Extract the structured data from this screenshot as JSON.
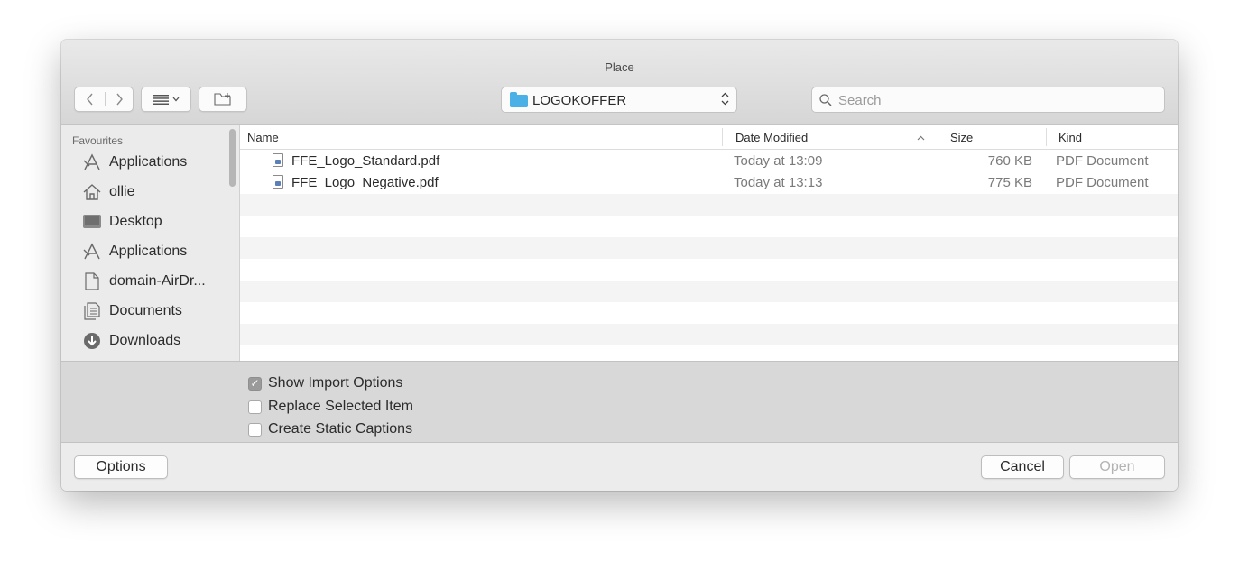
{
  "window": {
    "title": "Place"
  },
  "toolbar": {
    "back_icon": "chevron-left-icon",
    "forward_icon": "chevron-right-icon",
    "view_icon": "list-view-icon",
    "new_folder_icon": "new-folder-icon",
    "location": "LOGOKOFFER",
    "search_placeholder": "Search"
  },
  "sidebar": {
    "heading": "Favourites",
    "items": [
      {
        "label": "Applications",
        "icon": "applications-icon"
      },
      {
        "label": "ollie",
        "icon": "home-icon"
      },
      {
        "label": "Desktop",
        "icon": "desktop-icon"
      },
      {
        "label": "Applications",
        "icon": "applications-icon"
      },
      {
        "label": "domain-AirDr...",
        "icon": "document-icon"
      },
      {
        "label": "Documents",
        "icon": "documents-icon"
      },
      {
        "label": "Downloads",
        "icon": "downloads-icon"
      }
    ]
  },
  "columns": {
    "name": "Name",
    "date": "Date Modified",
    "size": "Size",
    "kind": "Kind"
  },
  "files": [
    {
      "name": "FFE_Logo_Standard.pdf",
      "date": "Today at 13:09",
      "size": "760 KB",
      "kind": "PDF Document"
    },
    {
      "name": "FFE_Logo_Negative.pdf",
      "date": "Today at 13:13",
      "size": "775 KB",
      "kind": "PDF Document"
    }
  ],
  "options": [
    {
      "label": "Show Import Options",
      "checked": true
    },
    {
      "label": "Replace Selected Item",
      "checked": false
    },
    {
      "label": "Create Static Captions",
      "checked": false
    }
  ],
  "buttons": {
    "options": "Options",
    "cancel": "Cancel",
    "open": "Open"
  },
  "colors": {
    "accent_folder": "#4ab0e6",
    "background": "#ececec"
  }
}
